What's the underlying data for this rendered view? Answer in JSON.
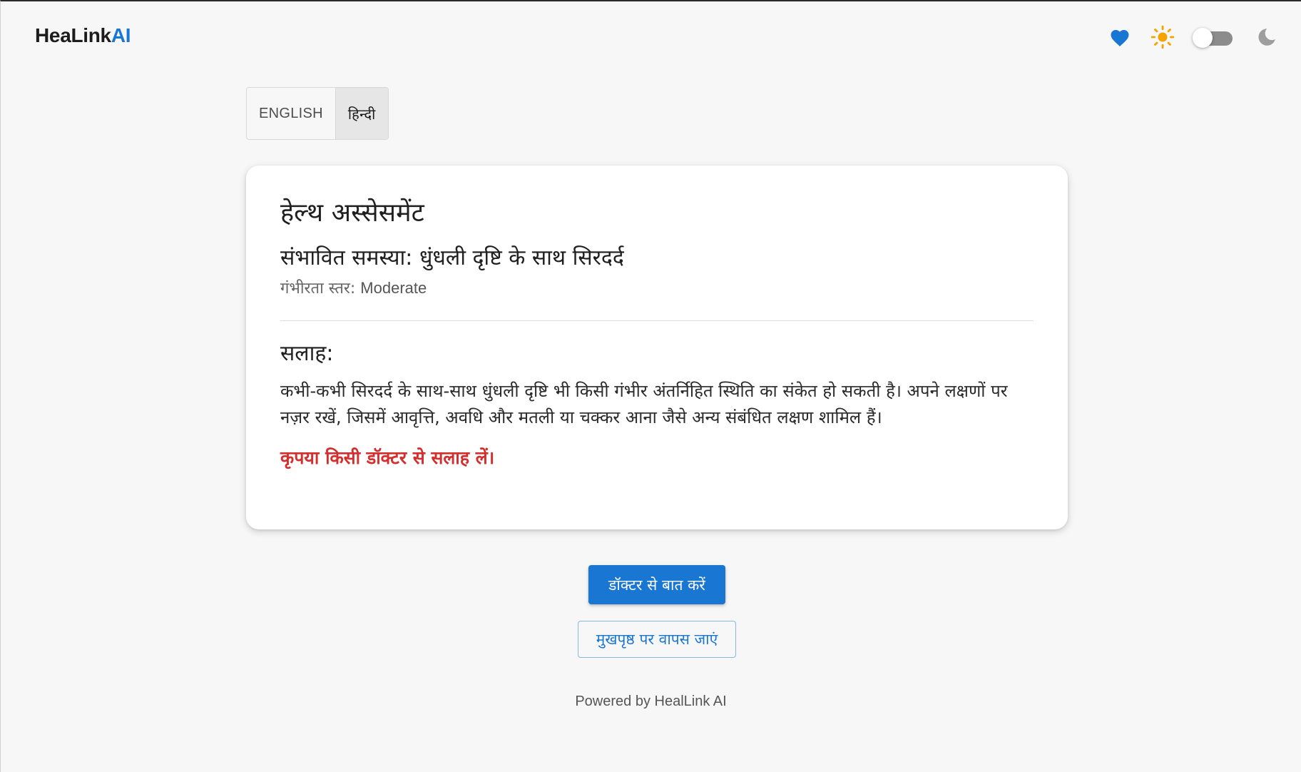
{
  "header": {
    "logo_main": "HeaLink",
    "logo_accent": "AI",
    "icons": [
      "heart-icon",
      "sun-icon",
      "theme-toggle",
      "moon-icon"
    ],
    "theme_toggle_on": false
  },
  "language": {
    "options": [
      "ENGLISH",
      "हिन्दी"
    ],
    "selected": "हिन्दी"
  },
  "assessment": {
    "title": "हेल्थ अस्सेसमेंट",
    "problem_label": "संभावित समस्या:",
    "problem_value": "धुंधली दृष्टि के साथ सिरदर्द",
    "severity_label": "गंभीरता स्तर:",
    "severity_value": "Moderate",
    "advice_heading": "सलाह:",
    "advice_text": "कभी-कभी सिरदर्द के साथ-साथ धुंधली दृष्टि भी किसी गंभीर अंतर्निहित स्थिति का संकेत हो सकती है। अपने लक्षणों पर नज़र रखें, जिसमें आवृत्ति, अवधि और मतली या चक्कर आना जैसे अन्य संबंधित लक्षण शामिल हैं।",
    "warning": "कृपया किसी डॉक्टर से सलाह लें।"
  },
  "actions": {
    "talk_to_doctor": "डॉक्टर से बात करें",
    "back_home": "मुखपृष्ठ पर वापस जाएं"
  },
  "footer": {
    "text": "Powered by HealLink AI"
  },
  "colors": {
    "accent": "#1976d2",
    "warning": "#d32f2f",
    "sun": "#f5a300",
    "moon": "#9e9e9e"
  }
}
